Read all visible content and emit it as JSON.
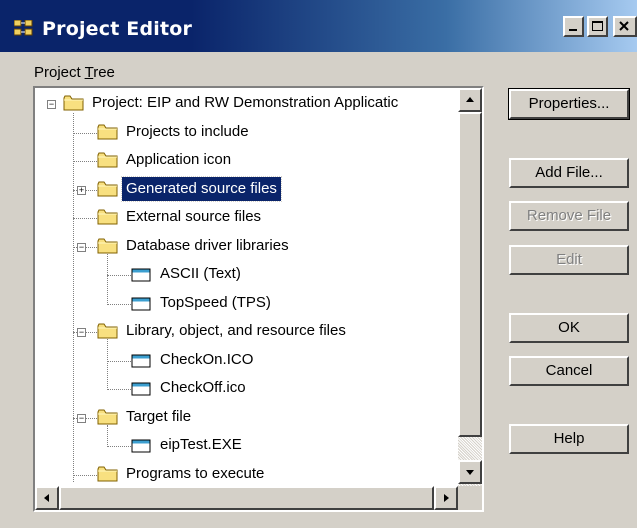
{
  "window": {
    "title": "Project Editor",
    "icon": "project-editor-icon"
  },
  "tree": {
    "group_label_pre": "Project ",
    "group_label_key": "T",
    "group_label_post": "ree",
    "items": [
      {
        "label": "Project: EIP and RW Demonstration Applicatic",
        "icon": "folder-icon",
        "expander": "minus"
      },
      {
        "label": "Projects to include",
        "icon": "folder-icon",
        "expander": ""
      },
      {
        "label": "Application icon",
        "icon": "folder-icon",
        "expander": ""
      },
      {
        "label": "Generated source files",
        "icon": "folder-icon",
        "expander": "plus",
        "selected": true
      },
      {
        "label": "External source files",
        "icon": "folder-icon",
        "expander": ""
      },
      {
        "label": "Database driver libraries",
        "icon": "folder-icon",
        "expander": "minus"
      },
      {
        "label": "ASCII (Text)",
        "icon": "file-icon",
        "expander": ""
      },
      {
        "label": "TopSpeed (TPS)",
        "icon": "file-icon",
        "expander": ""
      },
      {
        "label": "Library, object, and resource files",
        "icon": "folder-icon",
        "expander": "minus"
      },
      {
        "label": "CheckOn.ICO",
        "icon": "file-icon",
        "expander": ""
      },
      {
        "label": "CheckOff.ico",
        "icon": "file-icon",
        "expander": ""
      },
      {
        "label": "Target file",
        "icon": "folder-icon",
        "expander": "minus"
      },
      {
        "label": "eipTest.EXE",
        "icon": "file-icon",
        "expander": ""
      },
      {
        "label": "Programs to execute",
        "icon": "folder-icon",
        "expander": ""
      }
    ]
  },
  "buttons": {
    "properties": "Properties...",
    "add_file": "Add File...",
    "remove_file": "Remove File",
    "edit": "Edit",
    "ok": "OK",
    "cancel": "Cancel",
    "help": "Help"
  },
  "colors": {
    "title_bar_start": "#0a246a",
    "title_bar_end": "#a6caf0",
    "selection": "#0a246a",
    "face": "#d4d0c8",
    "folder": "#f8e080"
  }
}
